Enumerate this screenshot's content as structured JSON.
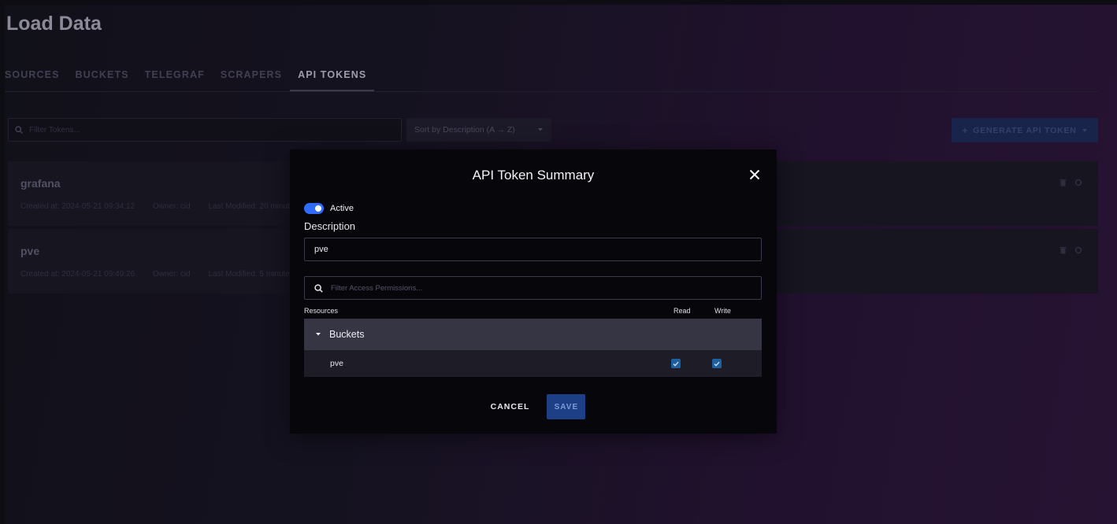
{
  "page": {
    "title": "Load Data"
  },
  "tabs": [
    {
      "label": "SOURCES",
      "active": false
    },
    {
      "label": "BUCKETS",
      "active": false
    },
    {
      "label": "TELEGRAF",
      "active": false
    },
    {
      "label": "SCRAPERS",
      "active": false
    },
    {
      "label": "API TOKENS",
      "active": true
    }
  ],
  "toolbar": {
    "search_placeholder": "Filter Tokens...",
    "sort_label": "Sort by Description (A → Z)",
    "generate_label": "GENERATE API TOKEN"
  },
  "tokens": [
    {
      "name": "grafana",
      "created": "Created at: 2024-05-21 09:34:12",
      "owner": "Owner: cid",
      "modified": "Last Modified: 20 minutes ago"
    },
    {
      "name": "pve",
      "created": "Created at: 2024-05-21 09:49:26",
      "owner": "Owner: cid",
      "modified": "Last Modified: 5 minutes ago"
    }
  ],
  "modal": {
    "title": "API Token Summary",
    "active_label": "Active",
    "active": true,
    "description_label": "Description",
    "description_value": "pve",
    "filter_placeholder": "Filter Access Permissions...",
    "columns": {
      "resources": "Resources",
      "read": "Read",
      "write": "Write"
    },
    "group": {
      "label": "Buckets"
    },
    "items": [
      {
        "name": "pve",
        "read": true,
        "write": true
      }
    ],
    "cancel_label": "CANCEL",
    "save_label": "SAVE"
  },
  "colors": {
    "accent": "#2f6bff",
    "checkbox": "#1e5fa0",
    "save_button": "#1d3f86"
  }
}
